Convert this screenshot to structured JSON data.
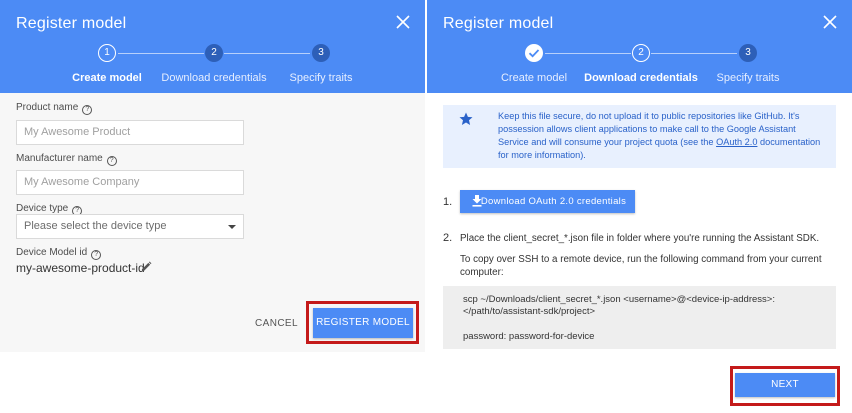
{
  "left": {
    "header": {
      "title": "Register model"
    },
    "steps": [
      {
        "number": "1",
        "label": "Create model"
      },
      {
        "number": "2",
        "label": "Download credentials"
      },
      {
        "number": "3",
        "label": "Specify traits"
      }
    ],
    "fields": {
      "product_name_label": "Product name",
      "product_name_placeholder": "My Awesome Product",
      "manufacturer_label": "Manufacturer name",
      "manufacturer_placeholder": "My Awesome Company",
      "device_type_label": "Device type",
      "device_type_value": "Please select the device type",
      "model_id_label": "Device Model id",
      "model_id_value": "my-awesome-product-id"
    },
    "buttons": {
      "cancel": "CANCEL",
      "register": "REGISTER MODEL"
    }
  },
  "right": {
    "header": {
      "title": "Register model"
    },
    "steps": [
      {
        "number": "",
        "label": "Create model"
      },
      {
        "number": "2",
        "label": "Download credentials"
      },
      {
        "number": "3",
        "label": "Specify traits"
      }
    ],
    "notice": {
      "text_before_link": "Keep this file secure, do not upload it to public repositories like GitHub. It's possession allows client applications to make call to the Google Assistant Service and will consume your project quota (see the ",
      "link": "OAuth 2.0",
      "text_after_link": " documentation for more information)."
    },
    "step1_number": "1.",
    "download_button": "Download OAuth 2.0 credentials",
    "step2_number": "2.",
    "step2_text": "Place the client_secret_*.json file in folder where you're running the Assistant SDK.",
    "ssh_text": "To copy over SSH to a remote device, run the following command from your current computer:",
    "code_line1": "scp ~/Downloads/client_secret_*.json <username>@<device-ip-address>:</path/to/assistant-sdk/project>",
    "code_line2": "password: password-for-device",
    "next_button": "NEXT"
  },
  "colors": {
    "header_blue": "#4c8bf5",
    "highlight_red": "#c41a1a",
    "notice_bg": "#e8f0fe"
  }
}
